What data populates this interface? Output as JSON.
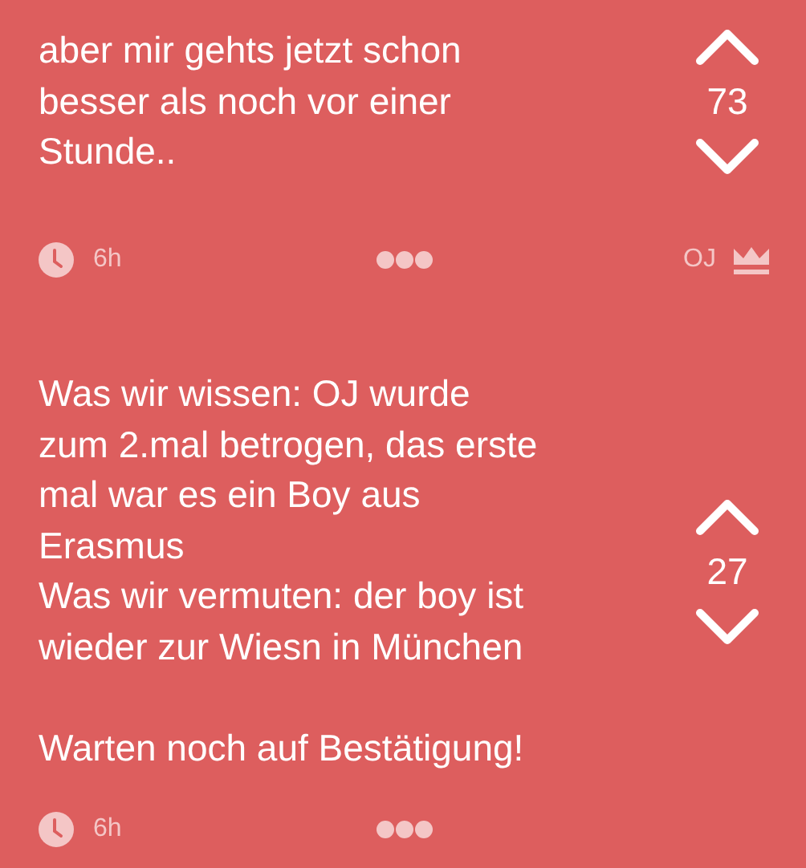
{
  "posts": [
    {
      "text": "aber mir gehts jetzt schon\nbesser als noch vor einer\nStunde..",
      "votes": "73",
      "time": "6h",
      "author": "OJ"
    },
    {
      "text": "Was wir wissen: OJ wurde\nzum 2.mal betrogen, das erste\nmal war es ein Boy aus\nErasmus\nWas wir vermuten: der boy ist\nwieder zur Wiesn in München\n\nWarten noch auf Bestätigung!",
      "votes": "27",
      "time": "6h"
    }
  ]
}
